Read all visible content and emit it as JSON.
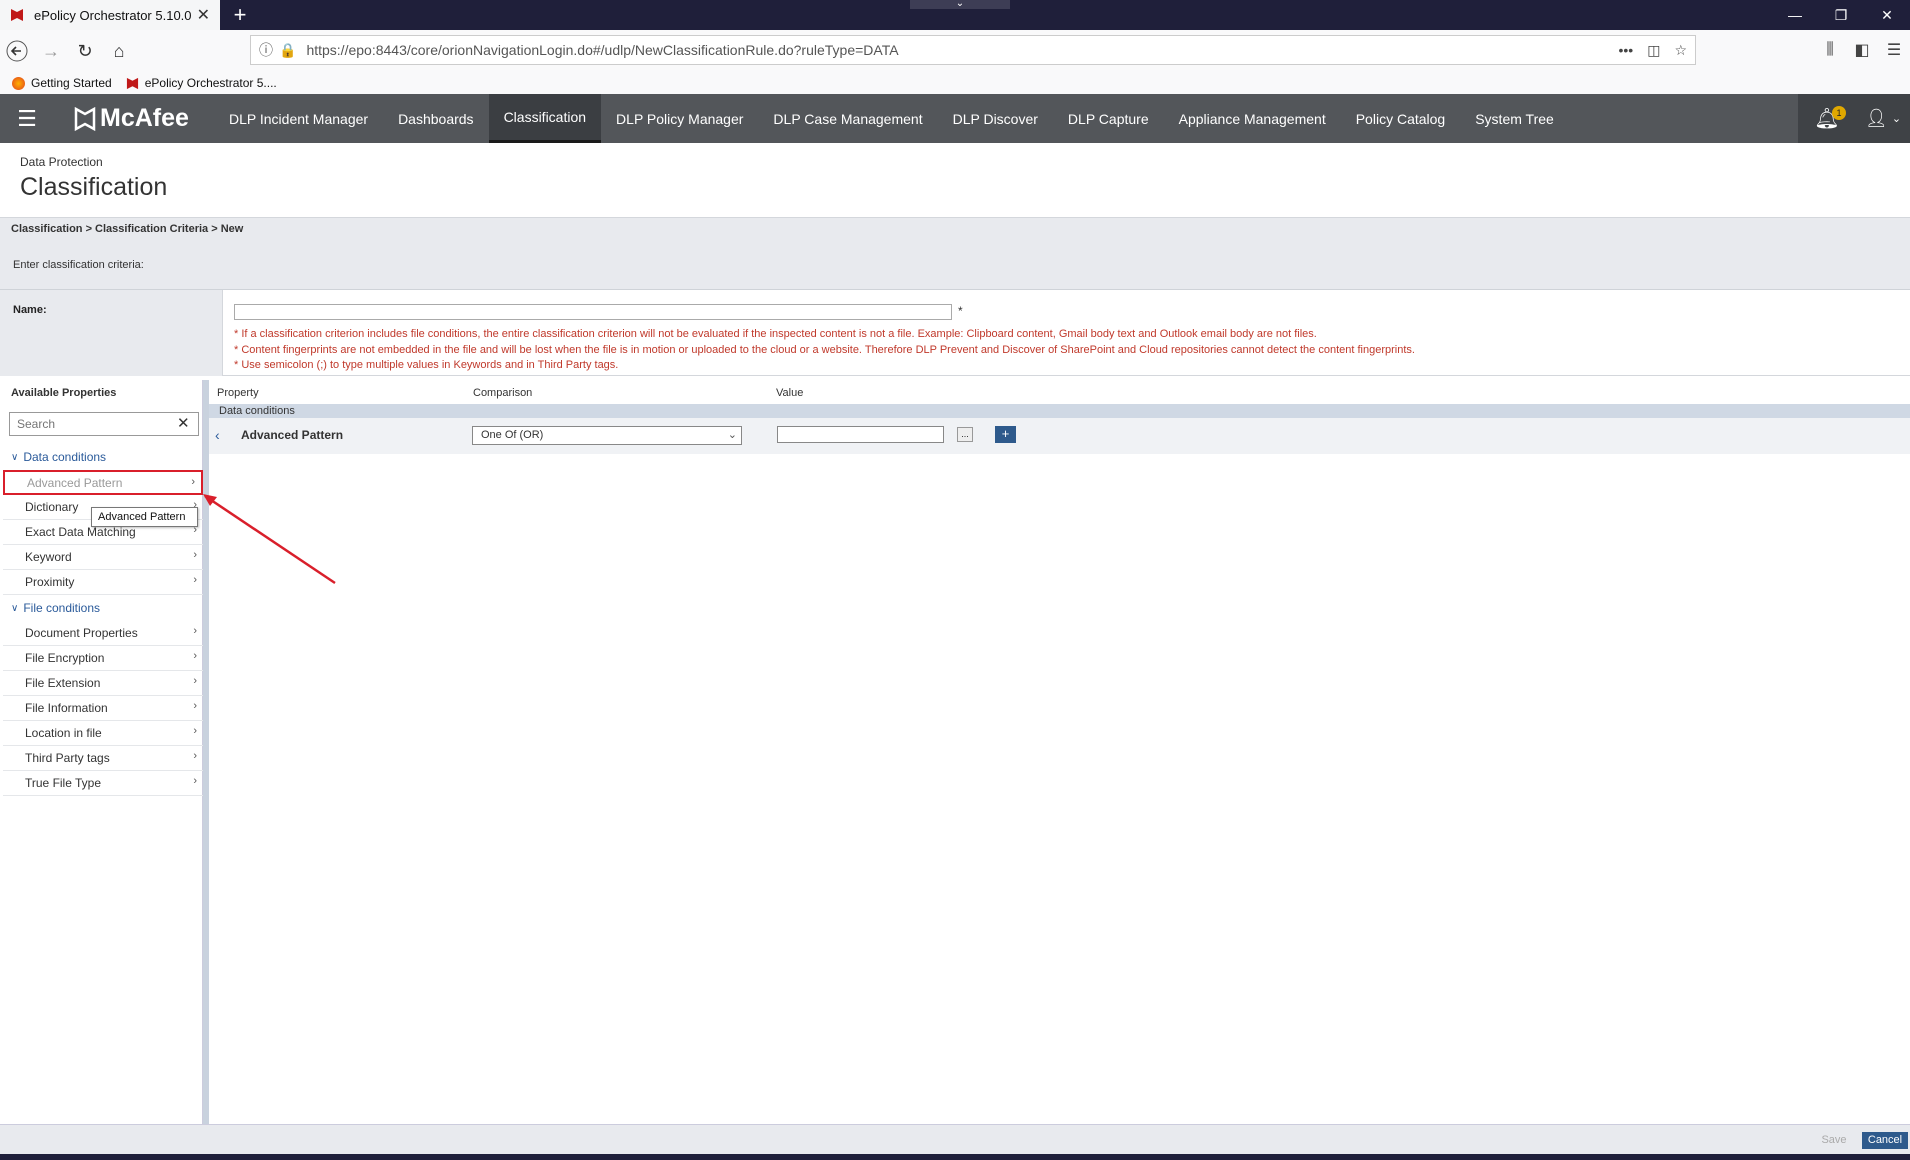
{
  "browser": {
    "tab_title": "ePolicy Orchestrator 5.10.0",
    "url": "https://epo:8443/core/orionNavigationLogin.do#/udlp/NewClassificationRule.do?ruleType=DATA",
    "bookmarks": [
      "Getting Started",
      "ePolicy Orchestrator 5...."
    ]
  },
  "app": {
    "logo": "McAfee",
    "menu": [
      {
        "label": "DLP Incident Manager"
      },
      {
        "label": "Dashboards"
      },
      {
        "label": "Classification"
      },
      {
        "label": "DLP Policy Manager"
      },
      {
        "label": "DLP Case Management"
      },
      {
        "label": "DLP Discover"
      },
      {
        "label": "DLP Capture"
      },
      {
        "label": "Appliance Management"
      },
      {
        "label": "Policy Catalog"
      },
      {
        "label": "System Tree"
      }
    ],
    "active_menu": "Classification",
    "notification_count": "1"
  },
  "page": {
    "subtitle": "Data Protection",
    "title": "Classification",
    "breadcrumb": "Classification > Classification Criteria > New",
    "instruction": "Enter classification criteria:",
    "name_label": "Name:",
    "name_value": "",
    "required_mark": "*",
    "notes": [
      "* If a classification criterion includes file conditions, the entire classification criterion will not be evaluated if the inspected content is not a file. Example: Clipboard content, Gmail body text and Outlook email body are not files.",
      "* Content fingerprints are not embedded in the file and will be lost when the file is in motion or uploaded to the cloud or a website. Therefore DLP Prevent and Discover of SharePoint and Cloud repositories cannot detect the content fingerprints.",
      "* Use semicolon (;) to type multiple values in Keywords and in Third Party tags."
    ]
  },
  "left_panel": {
    "title": "Available Properties",
    "search_placeholder": "Search",
    "groups": [
      {
        "label": "Data conditions",
        "items": [
          "Advanced Pattern",
          "Dictionary",
          "Exact Data Matching",
          "Keyword",
          "Proximity"
        ]
      },
      {
        "label": "File conditions",
        "items": [
          "Document Properties",
          "File Encryption",
          "File Extension",
          "File Information",
          "Location in file",
          "Third Party tags",
          "True File Type"
        ]
      }
    ],
    "tooltip": "Advanced Pattern"
  },
  "grid": {
    "headers": {
      "property": "Property",
      "comparison": "Comparison",
      "value": "Value"
    },
    "section": "Data conditions",
    "row": {
      "property": "Advanced Pattern",
      "comparison": "One Of (OR)",
      "value": "",
      "more_button": "...",
      "add_button": "+"
    }
  },
  "footer": {
    "save": "Save",
    "cancel": "Cancel"
  },
  "colors": {
    "header_bg": "#53565a",
    "accent_blue": "#2e5a8c",
    "note_red": "#c0392b",
    "highlight_red": "#d91f2b"
  }
}
